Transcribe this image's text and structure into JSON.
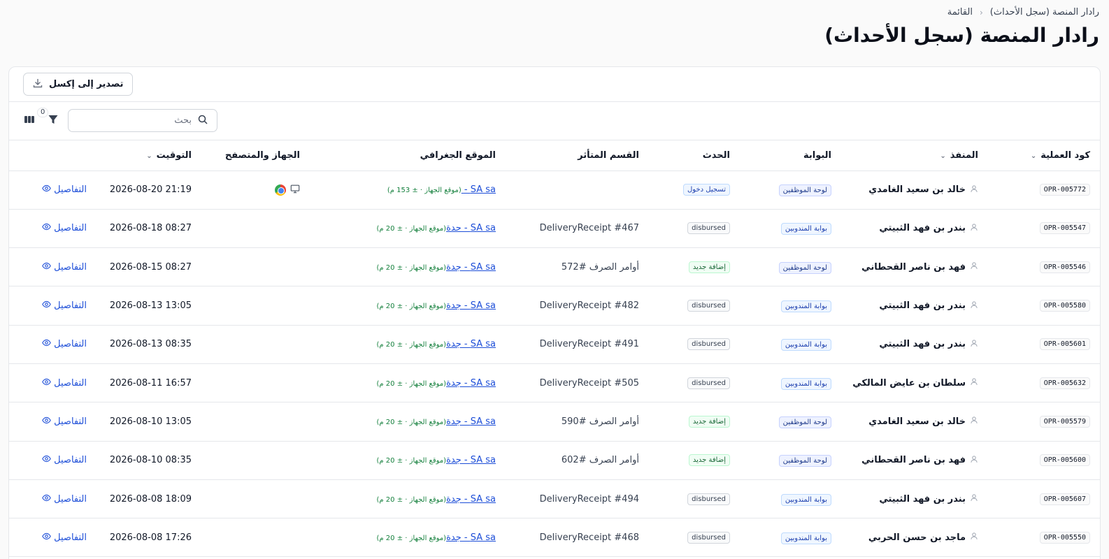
{
  "breadcrumb": {
    "root": "رادار المنصة (سجل الأحداث)",
    "current": "القائمة"
  },
  "page_title": "رادار المنصة (سجل الأحداث)",
  "toolbar": {
    "export_label": "تصدير إلى إكسل"
  },
  "filter_bar": {
    "search_placeholder": "بحث",
    "filter_count": "0"
  },
  "table": {
    "headers": {
      "code": "كود العملية",
      "actor": "المنفذ",
      "portal": "البوابة",
      "event": "الحدث",
      "section": "القسم المتأثر",
      "geo": "الموقع الجغرافي",
      "device": "الجهاز والمتصفح",
      "time": "التوقيت"
    },
    "details_label": "التفاصيل",
    "rows": [
      {
        "code": "OPR-005772",
        "actor": "خالد بن سعيد الغامدي",
        "portal": "لوحة الموظفين",
        "portal_type": "staff",
        "event": "تسجيل دخول",
        "event_type": "login",
        "section": "",
        "geo_link": "SA sa - ",
        "geo_acc": "(موقع الجهاز · ± 153 م)",
        "device": true,
        "time": "2026-08-20 21:19"
      },
      {
        "code": "OPR-005547",
        "actor": "بندر بن فهد الثبيتي",
        "portal": "بوابة المندوبين",
        "portal_type": "delegates",
        "event": "disbursed",
        "event_type": "neutral",
        "section": "DeliveryReceipt #467",
        "geo_link": "SA sa - جدة",
        "geo_acc": "(موقع الجهاز · ± 20 م)",
        "device": false,
        "time": "2026-08-18 08:27"
      },
      {
        "code": "OPR-005546",
        "actor": "فهد بن ناصر القحطاني",
        "portal": "لوحة الموظفين",
        "portal_type": "staff",
        "event": "إضافة جديد",
        "event_type": "new",
        "section": "أوامر الصرف #572",
        "geo_link": "SA sa - جدة",
        "geo_acc": "(موقع الجهاز · ± 20 م)",
        "device": false,
        "time": "2026-08-15 08:27"
      },
      {
        "code": "OPR-005580",
        "actor": "بندر بن فهد الثبيتي",
        "portal": "بوابة المندوبين",
        "portal_type": "delegates",
        "event": "disbursed",
        "event_type": "neutral",
        "section": "DeliveryReceipt #482",
        "geo_link": "SA sa - جدة",
        "geo_acc": "(موقع الجهاز · ± 20 م)",
        "device": false,
        "time": "2026-08-13 13:05"
      },
      {
        "code": "OPR-005601",
        "actor": "بندر بن فهد الثبيتي",
        "portal": "بوابة المندوبين",
        "portal_type": "delegates",
        "event": "disbursed",
        "event_type": "neutral",
        "section": "DeliveryReceipt #491",
        "geo_link": "SA sa - جدة",
        "geo_acc": "(موقع الجهاز · ± 20 م)",
        "device": false,
        "time": "2026-08-13 08:35"
      },
      {
        "code": "OPR-005632",
        "actor": "سلطان بن عايض المالكي",
        "portal": "بوابة المندوبين",
        "portal_type": "delegates",
        "event": "disbursed",
        "event_type": "neutral",
        "section": "DeliveryReceipt #505",
        "geo_link": "SA sa - جدة",
        "geo_acc": "(موقع الجهاز · ± 20 م)",
        "device": false,
        "time": "2026-08-11 16:57"
      },
      {
        "code": "OPR-005579",
        "actor": "خالد بن سعيد الغامدي",
        "portal": "لوحة الموظفين",
        "portal_type": "staff",
        "event": "إضافة جديد",
        "event_type": "new",
        "section": "أوامر الصرف #590",
        "geo_link": "SA sa - جدة",
        "geo_acc": "(موقع الجهاز · ± 20 م)",
        "device": false,
        "time": "2026-08-10 13:05"
      },
      {
        "code": "OPR-005600",
        "actor": "فهد بن ناصر القحطاني",
        "portal": "لوحة الموظفين",
        "portal_type": "staff",
        "event": "إضافة جديد",
        "event_type": "new",
        "section": "أوامر الصرف #602",
        "geo_link": "SA sa - جدة",
        "geo_acc": "(موقع الجهاز · ± 20 م)",
        "device": false,
        "time": "2026-08-10 08:35"
      },
      {
        "code": "OPR-005607",
        "actor": "بندر بن فهد الثبيتي",
        "portal": "بوابة المندوبين",
        "portal_type": "delegates",
        "event": "disbursed",
        "event_type": "neutral",
        "section": "DeliveryReceipt #494",
        "geo_link": "SA sa - جدة",
        "geo_acc": "(موقع الجهاز · ± 20 م)",
        "device": false,
        "time": "2026-08-08 18:09"
      },
      {
        "code": "OPR-005550",
        "actor": "ماجد بن حسن الحربي",
        "portal": "بوابة المندوبين",
        "portal_type": "delegates",
        "event": "disbursed",
        "event_type": "neutral",
        "section": "DeliveryReceipt #468",
        "geo_link": "SA sa - جدة",
        "geo_acc": "(موقع الجهاز · ± 20 م)",
        "device": false,
        "time": "2026-08-08 17:26"
      }
    ]
  }
}
